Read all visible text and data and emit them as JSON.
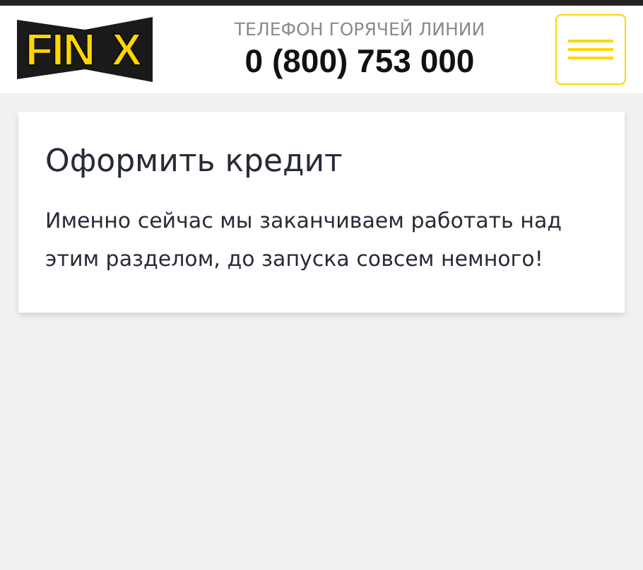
{
  "header": {
    "logo": {
      "left": "FIN",
      "right": "X"
    },
    "hotline_label": "ТЕЛЕФОН ГОРЯЧЕЙ ЛИНИИ",
    "phone": "0 (800) 753 000"
  },
  "card": {
    "title": "Оформить кредит",
    "text": "Именно сейчас мы заканчиваем работать над этим разделом, до запуска совсем немного!"
  }
}
